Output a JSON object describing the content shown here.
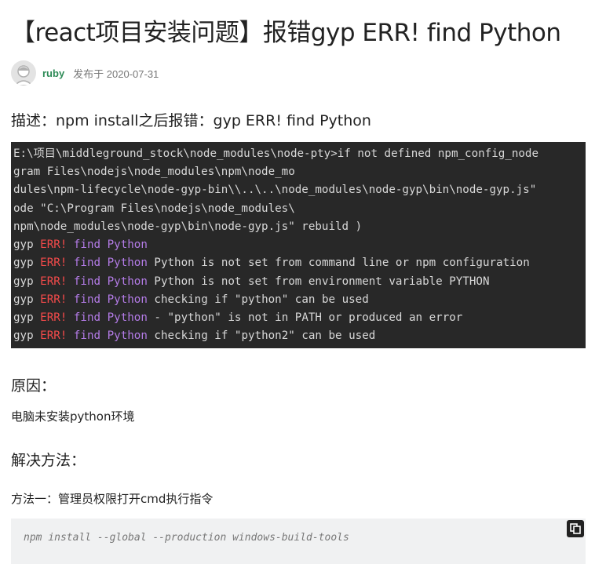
{
  "article": {
    "title": "【react项目安装问题】报错gyp ERR! find Python",
    "author": "ruby",
    "published": "发布于 2020-07-31"
  },
  "sections": {
    "description_heading": "描述：npm install之后报错：gyp ERR! find Python",
    "cause_heading": "原因：",
    "cause_text": "电脑未安装python环境",
    "solution_heading": "解决方法：",
    "method_text": "方法一：管理员权限打开cmd执行指令"
  },
  "terminal": {
    "plain_lines": [
      "E:\\项目\\middleground_stock\\node_modules\\node-pty>if not defined npm_config_node",
      "gram Files\\nodejs\\node_modules\\npm\\node_mo",
      "dules\\npm-lifecycle\\node-gyp-bin\\\\..\\..\\node_modules\\node-gyp\\bin\\node-gyp.js\"",
      "ode \"C:\\Program Files\\nodejs\\node_modules\\",
      "npm\\node_modules\\node-gyp\\bin\\node-gyp.js\" rebuild )"
    ],
    "gyp_lines": [
      {
        "gyp": "gyp",
        "err": "ERR!",
        "find": "find",
        "python": "Python",
        "msg": ""
      },
      {
        "gyp": "gyp",
        "err": "ERR!",
        "find": "find",
        "python": "Python",
        "msg": " Python is not set from command line or npm configuration"
      },
      {
        "gyp": "gyp",
        "err": "ERR!",
        "find": "find",
        "python": "Python",
        "msg": " Python is not set from environment variable PYTHON"
      },
      {
        "gyp": "gyp",
        "err": "ERR!",
        "find": "find",
        "python": "Python",
        "msg": " checking if \"python\" can be used"
      },
      {
        "gyp": "gyp",
        "err": "ERR!",
        "find": "find",
        "python": "Python",
        "msg": " - \"python\" is not in PATH or produced an error"
      },
      {
        "gyp": "gyp",
        "err": "ERR!",
        "find": "find",
        "python": "Python",
        "msg": " checking if \"python2\" can be used"
      }
    ]
  },
  "code": {
    "command": "npm install --global --production windows-build-tools",
    "copy_icon": "copy-icon"
  },
  "colors": {
    "author": "#2e8b57",
    "terminal_bg": "#282828",
    "err": "#f24a4a",
    "python": "#b37be6",
    "code_bg": "#f0f1f2"
  }
}
